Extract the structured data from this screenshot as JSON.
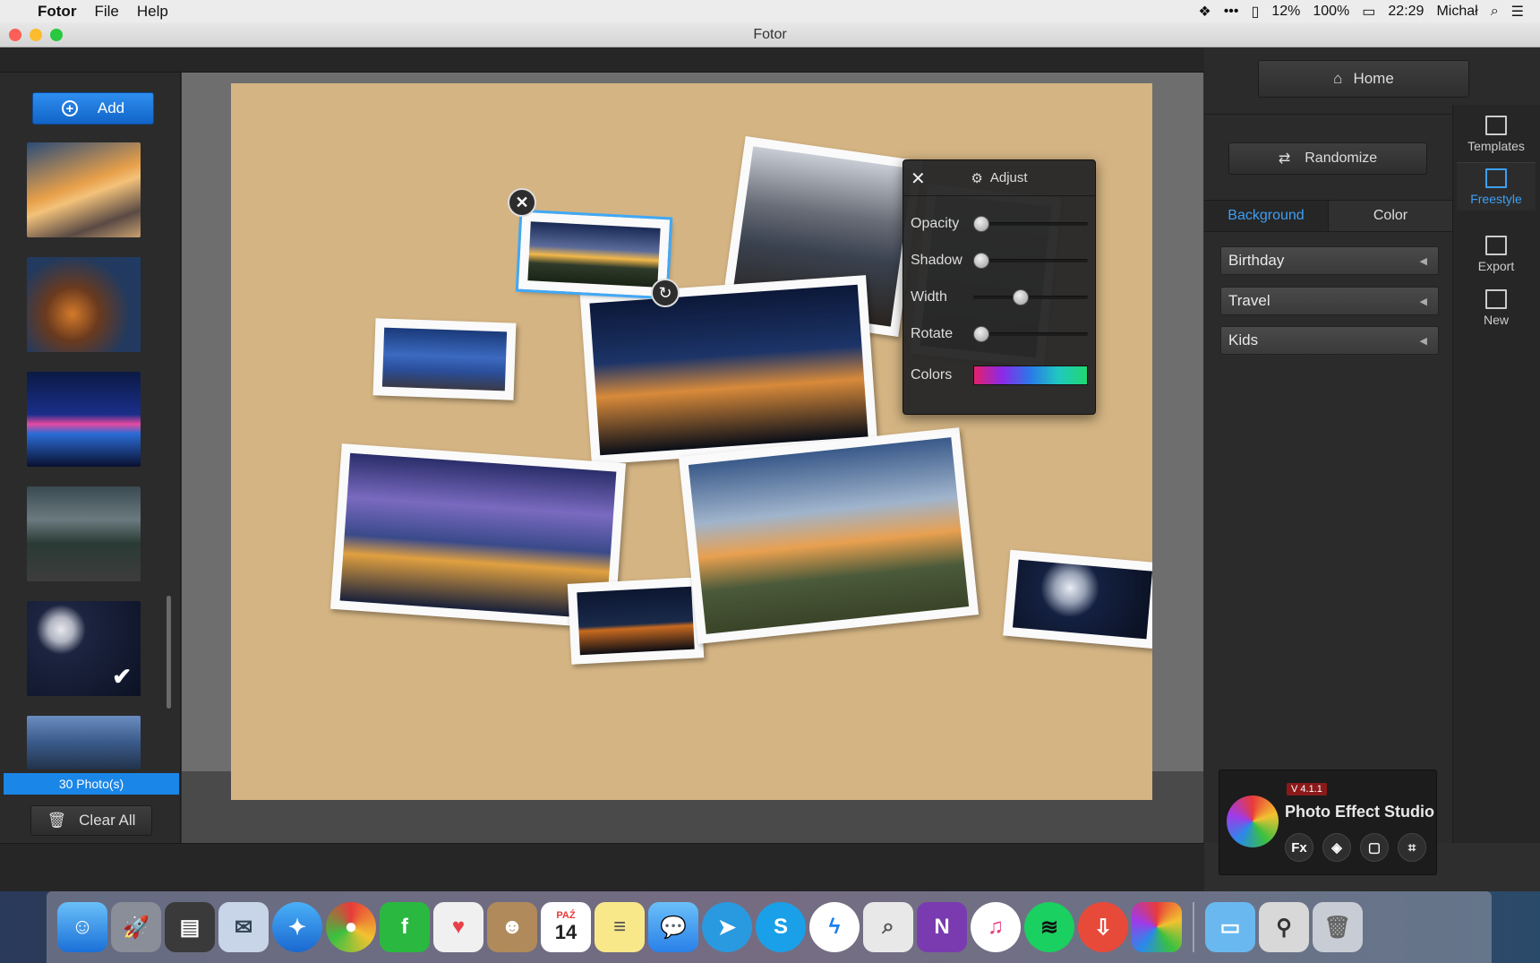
{
  "menubar": {
    "apple": "",
    "app_name": "Fotor",
    "menus": [
      "File",
      "Help"
    ],
    "status": {
      "battery_small": "12%",
      "battery": "100%",
      "time": "22:29",
      "user": "Michał"
    }
  },
  "window": {
    "title": "Fotor"
  },
  "left_panel": {
    "add_label": "Add",
    "photo_count": "30 Photo(s)",
    "clear_label": "Clear All"
  },
  "adjust": {
    "title": "Adjust",
    "rows": [
      {
        "label": "Opacity",
        "value": 0.0
      },
      {
        "label": "Shadow",
        "value": 0.0
      },
      {
        "label": "Width",
        "value": 0.4
      },
      {
        "label": "Rotate",
        "value": 0.0
      }
    ],
    "colors_label": "Colors"
  },
  "right_panel": {
    "home_label": "Home",
    "randomize_label": "Randomize",
    "tabs": [
      "Background",
      "Color"
    ],
    "categories": [
      "Birthday",
      "Travel",
      "Kids"
    ],
    "tools": [
      {
        "label": "Templates",
        "icon": "templates-icon"
      },
      {
        "label": "Freestyle",
        "icon": "freestyle-icon"
      },
      {
        "label": "Export",
        "icon": "export-icon"
      },
      {
        "label": "New",
        "icon": "new-icon"
      }
    ],
    "promo": {
      "version": "V 4.1.1",
      "title": "Photo Effect Studio",
      "buttons": [
        "Fx"
      ]
    }
  },
  "dock": {
    "calendar_month": "PAŹ",
    "calendar_day": "14"
  },
  "colors": {
    "accent": "#1a86e8",
    "canvas": "#d4b483",
    "selection": "#41a8f5"
  }
}
